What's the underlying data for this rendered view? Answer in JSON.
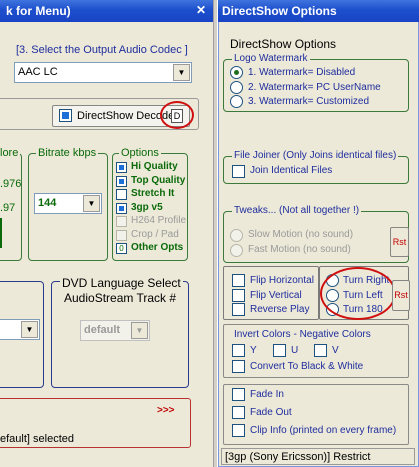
{
  "left_panel": {
    "title": "k for Menu)",
    "codec_label": "[3.  Select the Output Audio Codec ]",
    "codec_value": "AAC LC",
    "directshow_decode_label": "DirectShow Decode",
    "directshow_decode_btn": "D",
    "more_label": "lore",
    "freq_values": [
      ".976",
      ".97"
    ],
    "bitrate_label": "Bitrate  kbps",
    "bitrate_value": "144",
    "options_label": "Options",
    "options": [
      {
        "label": "Hi Quality",
        "checked": true,
        "enabled": true
      },
      {
        "label": "Top Quality",
        "checked": true,
        "enabled": true
      },
      {
        "label": "Stretch It",
        "checked": false,
        "enabled": true
      },
      {
        "label": "3gp v5",
        "checked": true,
        "enabled": true
      },
      {
        "label": "H264 Profile",
        "checked": false,
        "enabled": false
      },
      {
        "label": "Crop / Pad",
        "checked": false,
        "enabled": false
      },
      {
        "label": "Other Opts",
        "checked": false,
        "enabled": true,
        "box_text": "0"
      }
    ],
    "dvd_label_line1": "DVD Language Select",
    "dvd_label_line2": "AudioStream  Track #",
    "dvd_track_value": "default",
    "arrows_text": ">>>",
    "status_text": "efault] selected"
  },
  "right_panel": {
    "title": "DirectShow Options",
    "group_title": "DirectShow Options",
    "logo_watermark": {
      "label": "Logo Watermark",
      "options": [
        {
          "label": "1. Watermark= Disabled",
          "selected": true
        },
        {
          "label": "2. Watermark= PC UserName",
          "selected": false
        },
        {
          "label": "3. Watermark= Customized",
          "selected": false
        }
      ]
    },
    "file_joiner": {
      "label": "File Joiner (Only Joins identical files)",
      "checkbox_label": "Join Identical Files"
    },
    "tweaks": {
      "label": "Tweaks... (Not all together !)",
      "slow_motion": "Slow Motion (no sound)",
      "fast_motion": "Fast Motion (no sound)",
      "reset_btn": "Rst"
    },
    "flip": {
      "items": [
        "Flip Horizontal",
        "Flip Vertical",
        "Reverse Play"
      ],
      "turns": [
        "Turn Right",
        "Turn Left",
        "Turn 180"
      ],
      "reset_btn": "Rst"
    },
    "invert": {
      "label": "Invert Colors - Negative Colors",
      "channels": [
        "Y",
        "U",
        "V"
      ],
      "bw_label": "Convert To Black & White"
    },
    "fades": [
      "Fade In",
      "Fade Out",
      "Clip Info (printed on every frame)"
    ],
    "status_text": "[3gp  (Sony Ericsson)] Restrict"
  },
  "colors": {
    "title_blue": "#1c4fcd",
    "group_green": "#3b7a3b",
    "group_navy": "#283c8c",
    "highlight_red": "#d01010"
  }
}
